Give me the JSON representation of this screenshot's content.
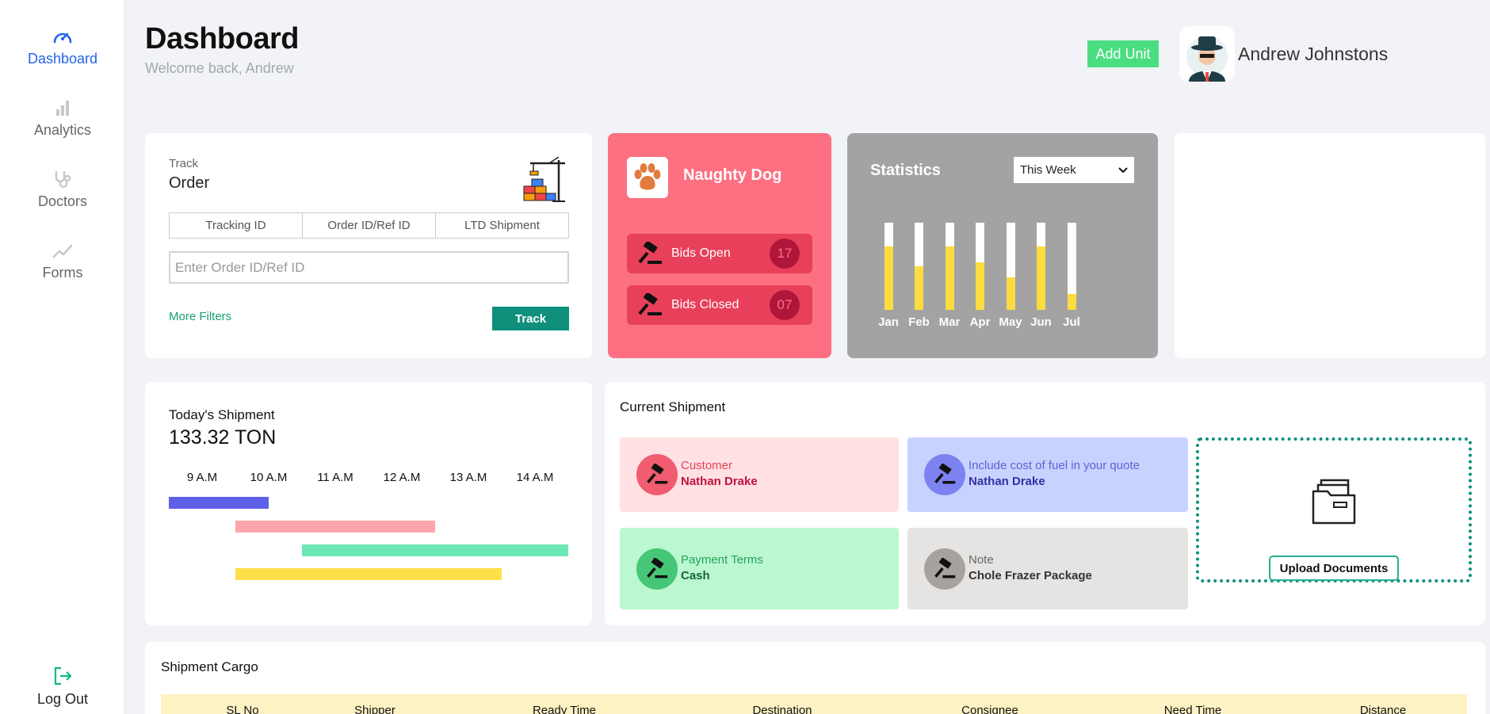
{
  "sidebar": {
    "items": [
      {
        "label": "Dashboard",
        "icon": "speedometer-icon",
        "active": true
      },
      {
        "label": "Analytics",
        "icon": "bar-chart-icon",
        "active": false
      },
      {
        "label": "Doctors",
        "icon": "stethoscope-icon",
        "active": false
      },
      {
        "label": "Forms",
        "icon": "trend-line-icon",
        "active": false
      }
    ],
    "logout_label": "Log Out"
  },
  "header": {
    "title": "Dashboard",
    "subtitle": "Welcome back, Andrew",
    "add_unit_label": "Add Unit",
    "user_name": "Andrew Johnstons"
  },
  "track": {
    "label": "Track",
    "title": "Order",
    "tabs": [
      "Tracking ID",
      "Order ID/Ref ID",
      "LTD Shipment"
    ],
    "input_placeholder": "Enter Order ID/Ref ID",
    "input_value": "",
    "more_filters_label": "More Filters",
    "track_button_label": "Track"
  },
  "naughty_dog": {
    "title": "Naughty Dog",
    "bids": [
      {
        "label": "Bids Open",
        "count": "17"
      },
      {
        "label": "Bids Closed",
        "count": "07"
      }
    ]
  },
  "statistics": {
    "title": "Statistics",
    "period_selected": "This Week",
    "months": [
      "Jan",
      "Feb",
      "Mar",
      "Apr",
      "May",
      "Jun",
      "Jul"
    ],
    "fill_fraction": [
      0.73,
      0.5,
      0.73,
      0.55,
      0.37,
      0.73,
      0.18
    ],
    "colors": {
      "fill": "#fcdc3e",
      "track": "#ffffff"
    }
  },
  "todays_shipment": {
    "title": "Today's Shipment",
    "value": "133.32 TON",
    "times": [
      "9 A.M",
      "10 A.M",
      "11 A.M",
      "12 A.M",
      "13 A.M",
      "14 A.M"
    ],
    "bars": [
      {
        "start": 0,
        "end": 1.5,
        "color": "#5d5fe7"
      },
      {
        "start": 1,
        "end": 4,
        "color": "#fda4ac"
      },
      {
        "start": 2,
        "end": 6,
        "color": "#6ee7b7"
      },
      {
        "start": 1,
        "end": 5,
        "color": "#fde047"
      }
    ]
  },
  "current_shipment": {
    "title": "Current Shipment",
    "tiles": [
      {
        "label": "Customer",
        "value": "Nathan Drake",
        "bg": "#ffe1e3",
        "icon_bg": "#f15c70",
        "label_color": "#e0465d",
        "value_color": "#c1123b"
      },
      {
        "label": "Include cost of fuel in your quote",
        "value": "Nathan Drake",
        "bg": "#c7d2fe",
        "icon_bg": "#7c83f0",
        "label_color": "#5b63d6",
        "value_color": "#3730a3"
      },
      {
        "label": "Payment Terms",
        "value": "Cash",
        "bg": "#bbf7d0",
        "icon_bg": "#45c777",
        "label_color": "#21a55a",
        "value_color": "#166534"
      },
      {
        "label": "Note",
        "value": "Chole Frazer Package",
        "bg": "#e5e4e2",
        "icon_bg": "#a8a29e",
        "label_color": "#666666",
        "value_color": "#333333"
      }
    ],
    "upload_label": "Upload Documents"
  },
  "shipment_cargo": {
    "title": "Shipment Cargo",
    "columns": [
      "SL No",
      "Shipper",
      "Ready Time",
      "Destination",
      "Consignee",
      "Need Time",
      "Distance"
    ]
  }
}
